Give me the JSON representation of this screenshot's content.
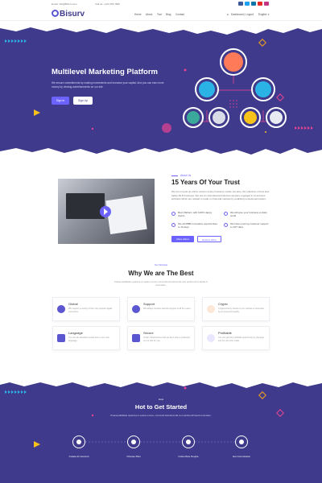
{
  "topbar": {
    "email": "Email: info@Bisurv.com",
    "phone": "Call us: +123 456 7890"
  },
  "header": {
    "logo": "Bisurv",
    "nav": [
      "Home",
      "About",
      "Tour",
      "Blog",
      "Contact"
    ],
    "account": "Dashboard | Logout",
    "language": "English"
  },
  "hero": {
    "title": "Multilevel Marketing Platform",
    "text": "We ensure commitments by making investments and increase your capital. And you can earn more money by viewing advertisements on our site.",
    "signin": "Sign In",
    "signup": "Sign Up"
  },
  "about": {
    "label": "About Us",
    "title": "15 Years Of Your Trust",
    "text": "We are not just an online version of any business model, but also, the reflection of best and safely MLM business. We are an international financial company engaged in investment activities which are related to trade on financial markets by qualified professional traders.",
    "features": [
      "Best Platform with 100% Happy clients",
      "We will give your business a sharp world",
      "We will 888k innovative opportunities to 16 days",
      "We have a strong customer support in 24/7 days"
    ],
    "btn_more": "More About",
    "btn_explore": "Explore More"
  },
  "why": {
    "label": "Our Website",
    "title": "Why We are The Best",
    "subtitle": "Praesentabilitate upploma ut opians omnes commodi dolorebus illa cum perferendi vi facilis in tenerisam.",
    "cards": [
      {
        "title": "Global",
        "desc": "We support a variety of the most popular digital currencies."
      },
      {
        "title": "Support",
        "desc": "We always remains favorite support to all the users."
      },
      {
        "title": "Crypto",
        "desc": "Cryptocurrency levels on our website is protected by an improved quality."
      },
      {
        "title": "Language",
        "desc": "You can do standard mutual site in your own language."
      },
      {
        "title": "Secure",
        "desc": "Under infrastructure that we don't stop a protection on our site for you."
      },
      {
        "title": "Profitable",
        "desc": "You can get the profitable opportunity by plunging into our site prior trade."
      }
    ]
  },
  "steps": {
    "label": "How",
    "title": "Hot to Get Started",
    "subtitle": "Praesentabilitate upploma ut opians omnes, commodi dolorebus illa cum perferendi faucis tenerisam.",
    "items": [
      "Create An Account",
      "Choose Plan",
      "Invite More People",
      "Get Commission"
    ]
  },
  "colors": {
    "primary": "#3f3a8c",
    "accent": "#6c63ff",
    "pink": "#e84393",
    "cyan": "#2bb3e6",
    "yellow": "#f7c21a"
  }
}
